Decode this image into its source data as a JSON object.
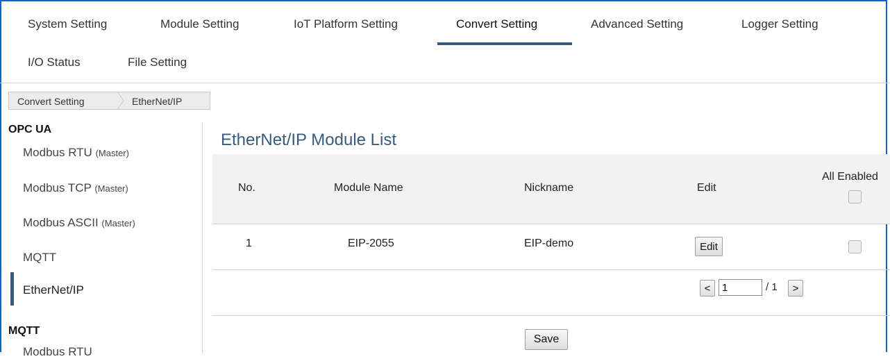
{
  "nav": {
    "tabs": [
      {
        "label": "System Setting"
      },
      {
        "label": "Module Setting"
      },
      {
        "label": "IoT Platform Setting"
      },
      {
        "label": "Convert Setting"
      },
      {
        "label": "Advanced Setting"
      },
      {
        "label": "Logger Setting"
      },
      {
        "label": "I/O Status"
      },
      {
        "label": "File Setting"
      }
    ],
    "active": "Convert Setting"
  },
  "breadcrumb": [
    "Convert Setting",
    "EtherNet/IP"
  ],
  "sidebar": {
    "sections": [
      {
        "title": "OPC UA",
        "items": [
          {
            "label": "Modbus RTU",
            "suffix": "(Master)"
          },
          {
            "label": "Modbus TCP",
            "suffix": "(Master)"
          },
          {
            "label": "Modbus ASCII",
            "suffix": "(Master)"
          },
          {
            "label": "MQTT",
            "suffix": ""
          },
          {
            "label": "EtherNet/IP",
            "suffix": ""
          }
        ]
      },
      {
        "title": "MQTT",
        "items": [
          {
            "label": "Modbus RTU",
            "suffix": ""
          }
        ]
      }
    ],
    "active_item": "EtherNet/IP"
  },
  "main": {
    "title": "EtherNet/IP Module List",
    "columns": [
      "No.",
      "Module Name",
      "Nickname",
      "Edit",
      "All Enabled"
    ],
    "rows": [
      {
        "no": "1",
        "module_name": "EIP-2055",
        "nickname": "EIP-demo",
        "edit_label": "Edit",
        "enabled": false
      }
    ],
    "all_enabled": false,
    "pagination": {
      "prev_label": "<",
      "page": "1",
      "total": "/ 1",
      "next_label": ">"
    },
    "save_label": "Save"
  },
  "colors": {
    "frame": "#0f63c9",
    "accent": "#375b80",
    "header_bg": "#f2f2f2"
  }
}
